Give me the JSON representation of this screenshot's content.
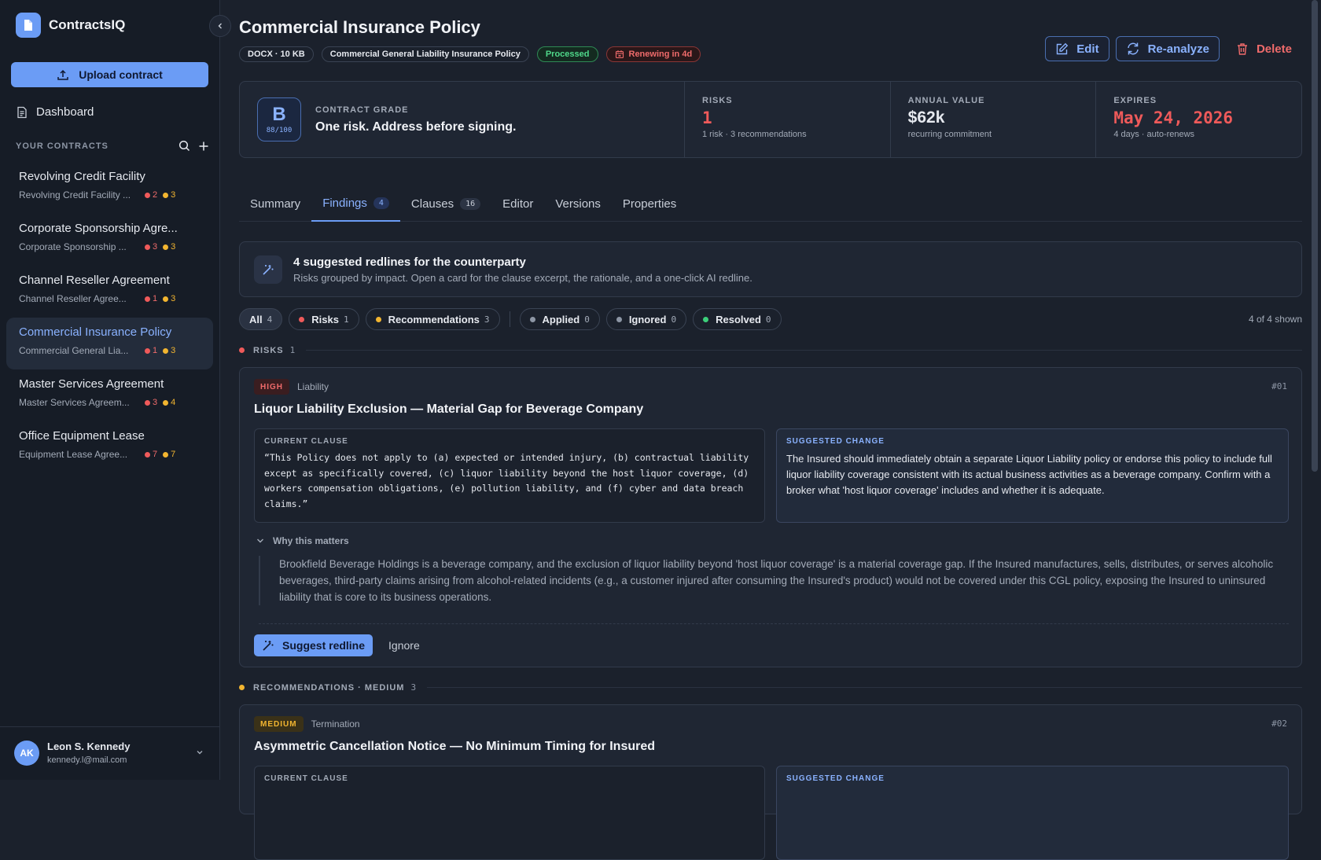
{
  "sidebar": {
    "brand": "ContractsIQ",
    "upload_label": "Upload contract",
    "dashboard_label": "Dashboard",
    "section_label": "YOUR CONTRACTS",
    "contracts": [
      {
        "title": "Revolving Credit Facility",
        "subtitle": "Revolving Credit Facility ...",
        "risks": "2",
        "recs": "3",
        "active": false
      },
      {
        "title": "Corporate Sponsorship Agre...",
        "subtitle": "Corporate Sponsorship ...",
        "risks": "3",
        "recs": "3",
        "active": false
      },
      {
        "title": "Channel Reseller Agreement",
        "subtitle": "Channel Reseller Agree...",
        "risks": "1",
        "recs": "3",
        "active": false
      },
      {
        "title": "Commercial Insurance Policy",
        "subtitle": "Commercial General Lia...",
        "risks": "1",
        "recs": "3",
        "active": true
      },
      {
        "title": "Master Services Agreement",
        "subtitle": "Master Services Agreem...",
        "risks": "3",
        "recs": "4",
        "active": false
      },
      {
        "title": "Office Equipment Lease",
        "subtitle": "Equipment Lease Agree...",
        "risks": "7",
        "recs": "7",
        "active": false
      }
    ],
    "user": {
      "initials": "AK",
      "name": "Leon S. Kennedy",
      "email": "kennedy.l@mail.com"
    }
  },
  "header": {
    "title": "Commercial Insurance Policy",
    "file_meta": "DOCX · 10 KB",
    "doc_type": "Commercial General Liability Insurance Policy",
    "status": "Processed",
    "renewal": "Renewing in 4d",
    "actions": {
      "edit": "Edit",
      "reanalyze": "Re-analyze",
      "delete": "Delete"
    }
  },
  "summary": {
    "grade_letter": "B",
    "grade_score": "88/100",
    "grade_caption": "CONTRACT GRADE",
    "grade_text": "One risk. Address before signing.",
    "risks": {
      "label": "RISKS",
      "value": "1",
      "sub": "1 risk · 3 recommendations"
    },
    "annual": {
      "label": "ANNUAL VALUE",
      "value": "$62k",
      "sub": "recurring commitment"
    },
    "expires": {
      "label": "EXPIRES",
      "value": "May 24, 2026",
      "sub": "4 days · auto-renews"
    }
  },
  "tabs": [
    {
      "label": "Summary",
      "count": ""
    },
    {
      "label": "Findings",
      "count": "4"
    },
    {
      "label": "Clauses",
      "count": "16"
    },
    {
      "label": "Editor",
      "count": ""
    },
    {
      "label": "Versions",
      "count": ""
    },
    {
      "label": "Properties",
      "count": ""
    }
  ],
  "info": {
    "title": "4 suggested redlines for the counterparty",
    "sub": "Risks grouped by impact. Open a card for the clause excerpt, the rationale, and a one-click AI redline."
  },
  "filters": {
    "all": {
      "label": "All",
      "n": "4"
    },
    "risks": {
      "label": "Risks",
      "n": "1"
    },
    "recs": {
      "label": "Recommendations",
      "n": "3"
    },
    "applied": {
      "label": "Applied",
      "n": "0"
    },
    "ignored": {
      "label": "Ignored",
      "n": "0"
    },
    "resolved": {
      "label": "Resolved",
      "n": "0"
    },
    "shown": "4 of 4 shown"
  },
  "sections": {
    "risks": {
      "label": "RISKS",
      "n": "1"
    },
    "recs": {
      "label": "RECOMMENDATIONS · MEDIUM",
      "n": "3"
    }
  },
  "findings": [
    {
      "severity": "HIGH",
      "category": "Liability",
      "num": "#01",
      "title": "Liquor Liability Exclusion — Material Gap for Beverage Company",
      "current_caption": "CURRENT CLAUSE",
      "current": "“This Policy does not apply to (a) expected or intended injury, (b) contractual liability except as specifically covered, (c) liquor liability beyond the host liquor coverage, (d) workers compensation obligations, (e) pollution liability, and (f) cyber and data breach claims.”",
      "suggested_caption": "SUGGESTED CHANGE",
      "suggested": "The Insured should immediately obtain a separate Liquor Liability policy or endorse this policy to include full liquor liability coverage consistent with its actual business activities as a beverage company. Confirm with a broker what 'host liquor coverage' includes and whether it is adequate.",
      "why_label": "Why this matters",
      "why": "Brookfield Beverage Holdings is a beverage company, and the exclusion of liquor liability beyond 'host liquor coverage' is a material coverage gap. If the Insured manufactures, sells, distributes, or serves alcoholic beverages, third-party claims arising from alcohol-related incidents (e.g., a customer injured after consuming the Insured's product) would not be covered under this CGL policy, exposing the Insured to uninsured liability that is core to its business operations.",
      "suggest_label": "Suggest redline",
      "ignore_label": "Ignore"
    },
    {
      "severity": "MEDIUM",
      "category": "Termination",
      "num": "#02",
      "title": "Asymmetric Cancellation Notice — No Minimum Timing for Insured",
      "current_caption": "CURRENT CLAUSE",
      "suggested_caption": "SUGGESTED CHANGE"
    }
  ],
  "colors": {
    "accent": "#6b9cf5",
    "risk": "#ef5a5a",
    "recommendation": "#f2b530",
    "resolved": "#3ccf7a"
  }
}
